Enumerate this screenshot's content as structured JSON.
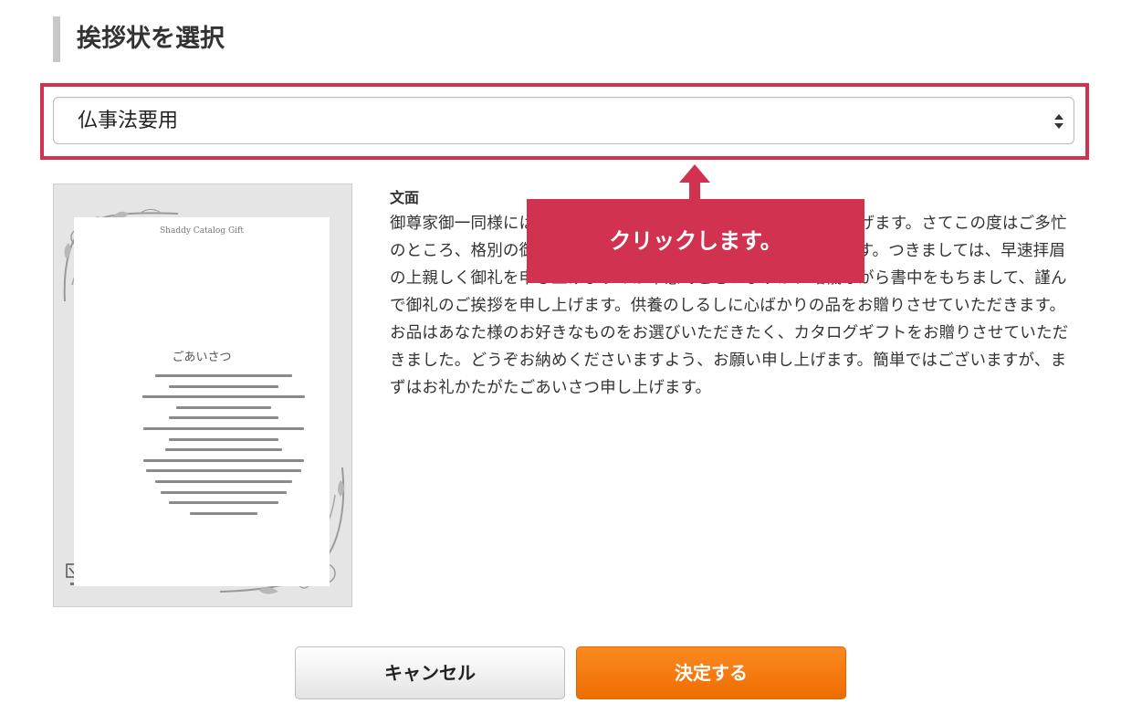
{
  "page": {
    "title": "挨拶状を選択"
  },
  "select": {
    "value": "仏事法要用"
  },
  "preview": {
    "brand": "Shaddy Catalog Gift",
    "heading": "ごあいさつ"
  },
  "message": {
    "label": "文面",
    "body": "御尊家御一同様にはお変わりなくお過ごしのこととお喜び申し上げます。さてこの度はご多忙のところ、格別の御厚志を賜り、誠に有難く厚く御礼申し上げます。つきましては、早速拝眉の上親しく御礼を申し上げますのが本意でございますが、略儀ながら書中をもちまして、謹んで御礼のご挨拶を申し上げます。供養のしるしに心ばかりの品をお贈りさせていただきます。お品はあなた様のお好きなものをお選びいただきたく、カタログギフトをお贈りさせていただきました。どうぞお納めくださいますよう、お願い申し上げます。簡単ではございますが、まずはお礼かたがたごあいさつ申し上げます。"
  },
  "tooltip": {
    "text": "クリックします。"
  },
  "buttons": {
    "cancel": "キャンセル",
    "confirm": "決定する"
  },
  "colors": {
    "accent": "#d0324f",
    "confirm": "#f07a10",
    "title_bar": "#c8c8c8"
  }
}
